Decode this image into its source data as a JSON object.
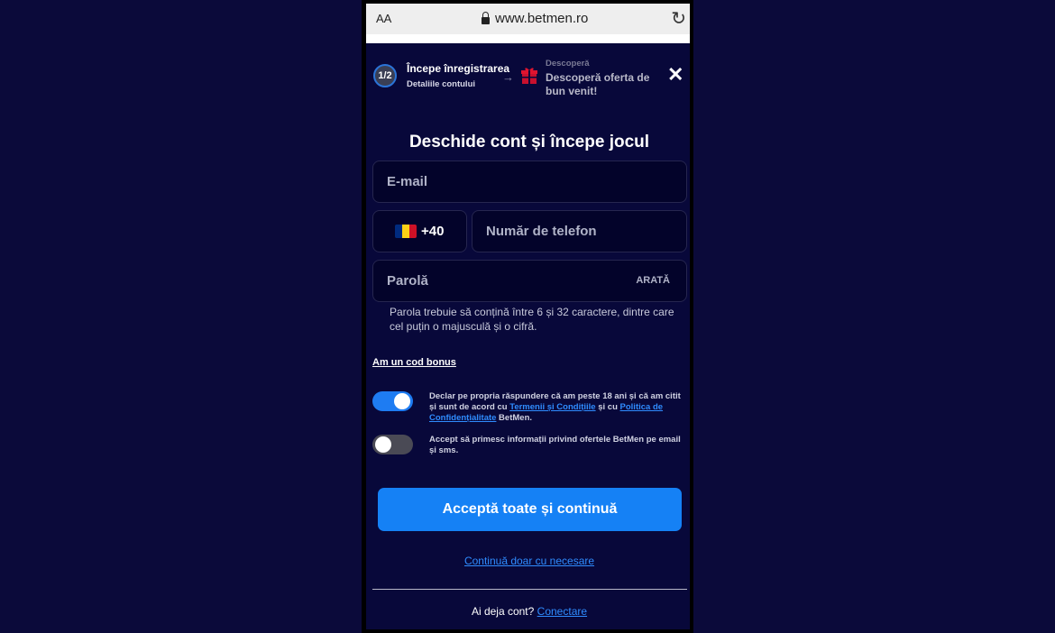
{
  "browser": {
    "aa_label": "AA",
    "url": "www.betmen.ro",
    "reload_glyph": "↻"
  },
  "steps": {
    "current_badge": "1/2",
    "current_title": "Începe înregistrarea",
    "current_subtitle": "Detaliile contului",
    "arrow": "→",
    "next_label": "Descoperă",
    "next_title": "Descoperă oferta de bun venit!",
    "close_glyph": "✕"
  },
  "form": {
    "heading": "Deschide cont și începe jocul",
    "email_placeholder": "E-mail",
    "country_code": "+40",
    "phone_placeholder": "Număr de telefon",
    "password_placeholder": "Parolă",
    "show_password": "ARATĂ",
    "password_hint": "Parola trebuie să conțină între 6 și 32 caractere, dintre care cel puțin o majusculă și o cifră.",
    "bonus_code_link": "Am un cod bonus"
  },
  "consents": {
    "age": {
      "enabled": true,
      "text_prefix": "Declar pe propria răspundere că am peste 18 ani și că am citit și sunt de acord cu ",
      "terms_link": "Termenii și Condițiile",
      "text_middle": " și cu ",
      "privacy_link": "Politica de Confidențialitate",
      "text_suffix": " BetMen."
    },
    "marketing": {
      "enabled": false,
      "text": "Accept să primesc informații privind ofertele BetMen pe email și sms."
    }
  },
  "actions": {
    "accept_all": "Acceptă toate și continuă",
    "continue_necessary": "Continuă doar cu necesare",
    "have_account": "Ai deja cont?",
    "login_link": "Conectare"
  },
  "colors": {
    "page_bg": "#0b0a3a",
    "app_bg": "#08083a",
    "accent": "#1581f5",
    "link": "#2f8cff",
    "flag": [
      "#002b7f",
      "#fcd116",
      "#ce1126"
    ]
  },
  "icons": [
    "lock-icon",
    "reload-icon",
    "gift-icon",
    "close-icon",
    "arrow-right-icon",
    "romania-flag-icon"
  ]
}
